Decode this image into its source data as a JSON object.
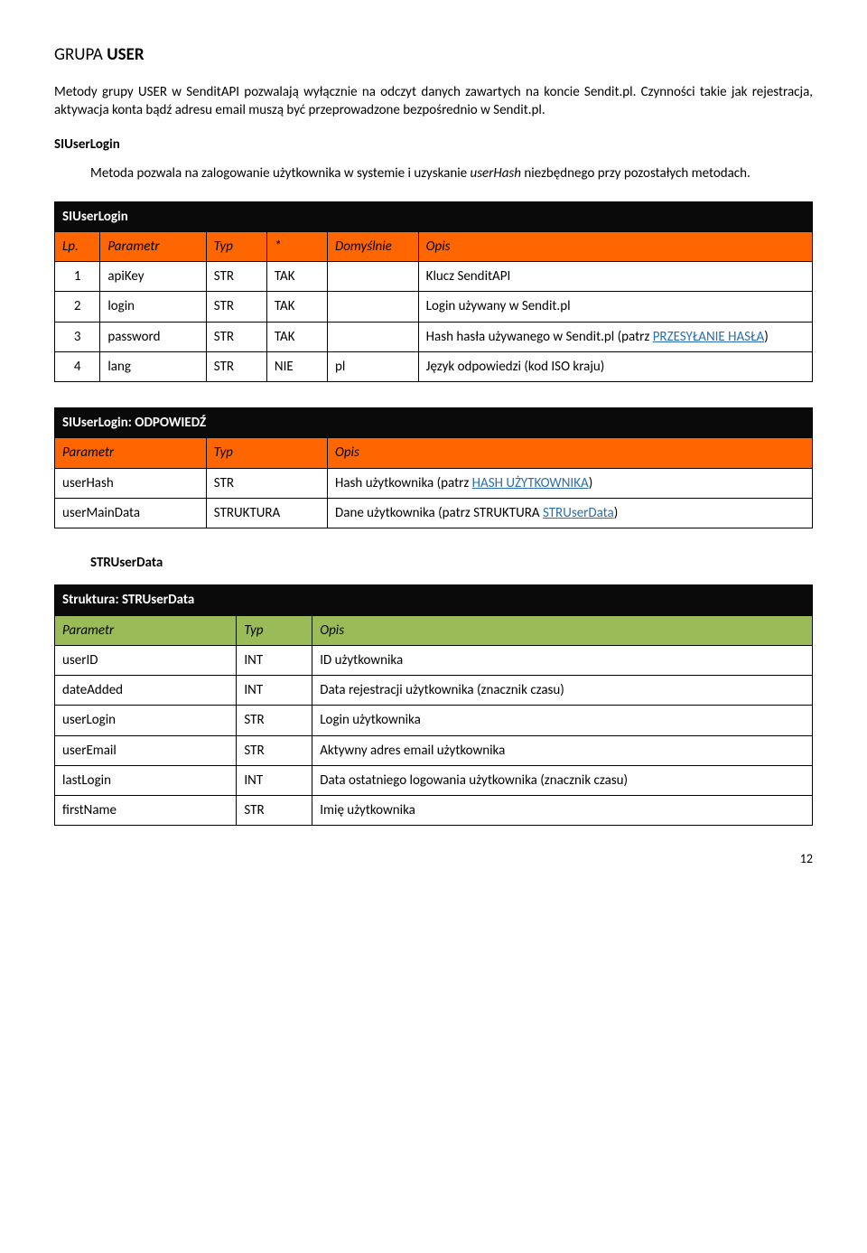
{
  "pageTitle": {
    "prefix": "GRUPA ",
    "bold": "USER"
  },
  "intro": "Metody grupy USER w SenditAPI pozwalają wyłącznie na odczyt danych zawartych na koncie Sendit.pl. Czynności takie jak rejestracja, aktywacja konta bądź adresu email muszą być przeprowadzone bezpośrednio w Sendit.pl.",
  "methodName": "SIUserLogin",
  "methodDesc": {
    "pre": "Metoda pozwala na zalogowanie użytkownika w systemie i uzyskanie ",
    "italic": "userHash",
    "post": " niezbędnego przy pozostałych metodach."
  },
  "paramsTable": {
    "title": "SIUserLogin",
    "headers": [
      "Lp.",
      "Parametr",
      "Typ",
      "*",
      "Domyślnie",
      "Opis"
    ],
    "rows": [
      {
        "lp": "1",
        "param": "apiKey",
        "typ": "STR",
        "star": "TAK",
        "def": "",
        "opis": {
          "text": "Klucz SenditAPI"
        }
      },
      {
        "lp": "2",
        "param": "login",
        "typ": "STR",
        "star": "TAK",
        "def": "",
        "opis": {
          "text": "Login używany w Sendit.pl"
        }
      },
      {
        "lp": "3",
        "param": "password",
        "typ": "STR",
        "star": "TAK",
        "def": "",
        "opis": {
          "pre": "Hash hasła używanego w Sendit.pl (patrz ",
          "linkText": "PRZESYŁANIE HASŁA",
          "post": ")"
        }
      },
      {
        "lp": "4",
        "param": "lang",
        "typ": "STR",
        "star": "NIE",
        "def": "pl",
        "opis": {
          "text": "Język odpowiedzi (kod ISO kraju)"
        }
      }
    ]
  },
  "responseTable": {
    "title": "SIUserLogin: ODPOWIEDŹ",
    "headers": [
      "Parametr",
      "Typ",
      "Opis"
    ],
    "rows": [
      {
        "param": "userHash",
        "typ": "STR",
        "opis": {
          "pre": "Hash użytkownika (patrz ",
          "linkText": "HASH UŻYTKOWNIKA",
          "post": ")"
        }
      },
      {
        "param": "userMainData",
        "typ": "STRUKTURA",
        "opis": {
          "pre": "Dane użytkownika (patrz STRUKTURA ",
          "linkText": "STRUserData",
          "post": ")"
        }
      }
    ]
  },
  "structSubheader": "STRUserData",
  "structTable": {
    "title": "Struktura: STRUserData",
    "headers": [
      "Parametr",
      "Typ",
      "Opis"
    ],
    "rows": [
      {
        "param": "userID",
        "typ": "INT",
        "opis": "ID użytkownika"
      },
      {
        "param": "dateAdded",
        "typ": "INT",
        "opis": "Data rejestracji użytkownika (znacznik czasu)"
      },
      {
        "param": "userLogin",
        "typ": "STR",
        "opis": "Login użytkownika"
      },
      {
        "param": "userEmail",
        "typ": "STR",
        "opis": "Aktywny adres email użytkownika"
      },
      {
        "param": "lastLogin",
        "typ": "INT",
        "opis": "Data ostatniego logowania użytkownika (znacznik czasu)"
      },
      {
        "param": "firstName",
        "typ": "STR",
        "opis": "Imię użytkownika"
      }
    ]
  },
  "pageNumber": "12"
}
